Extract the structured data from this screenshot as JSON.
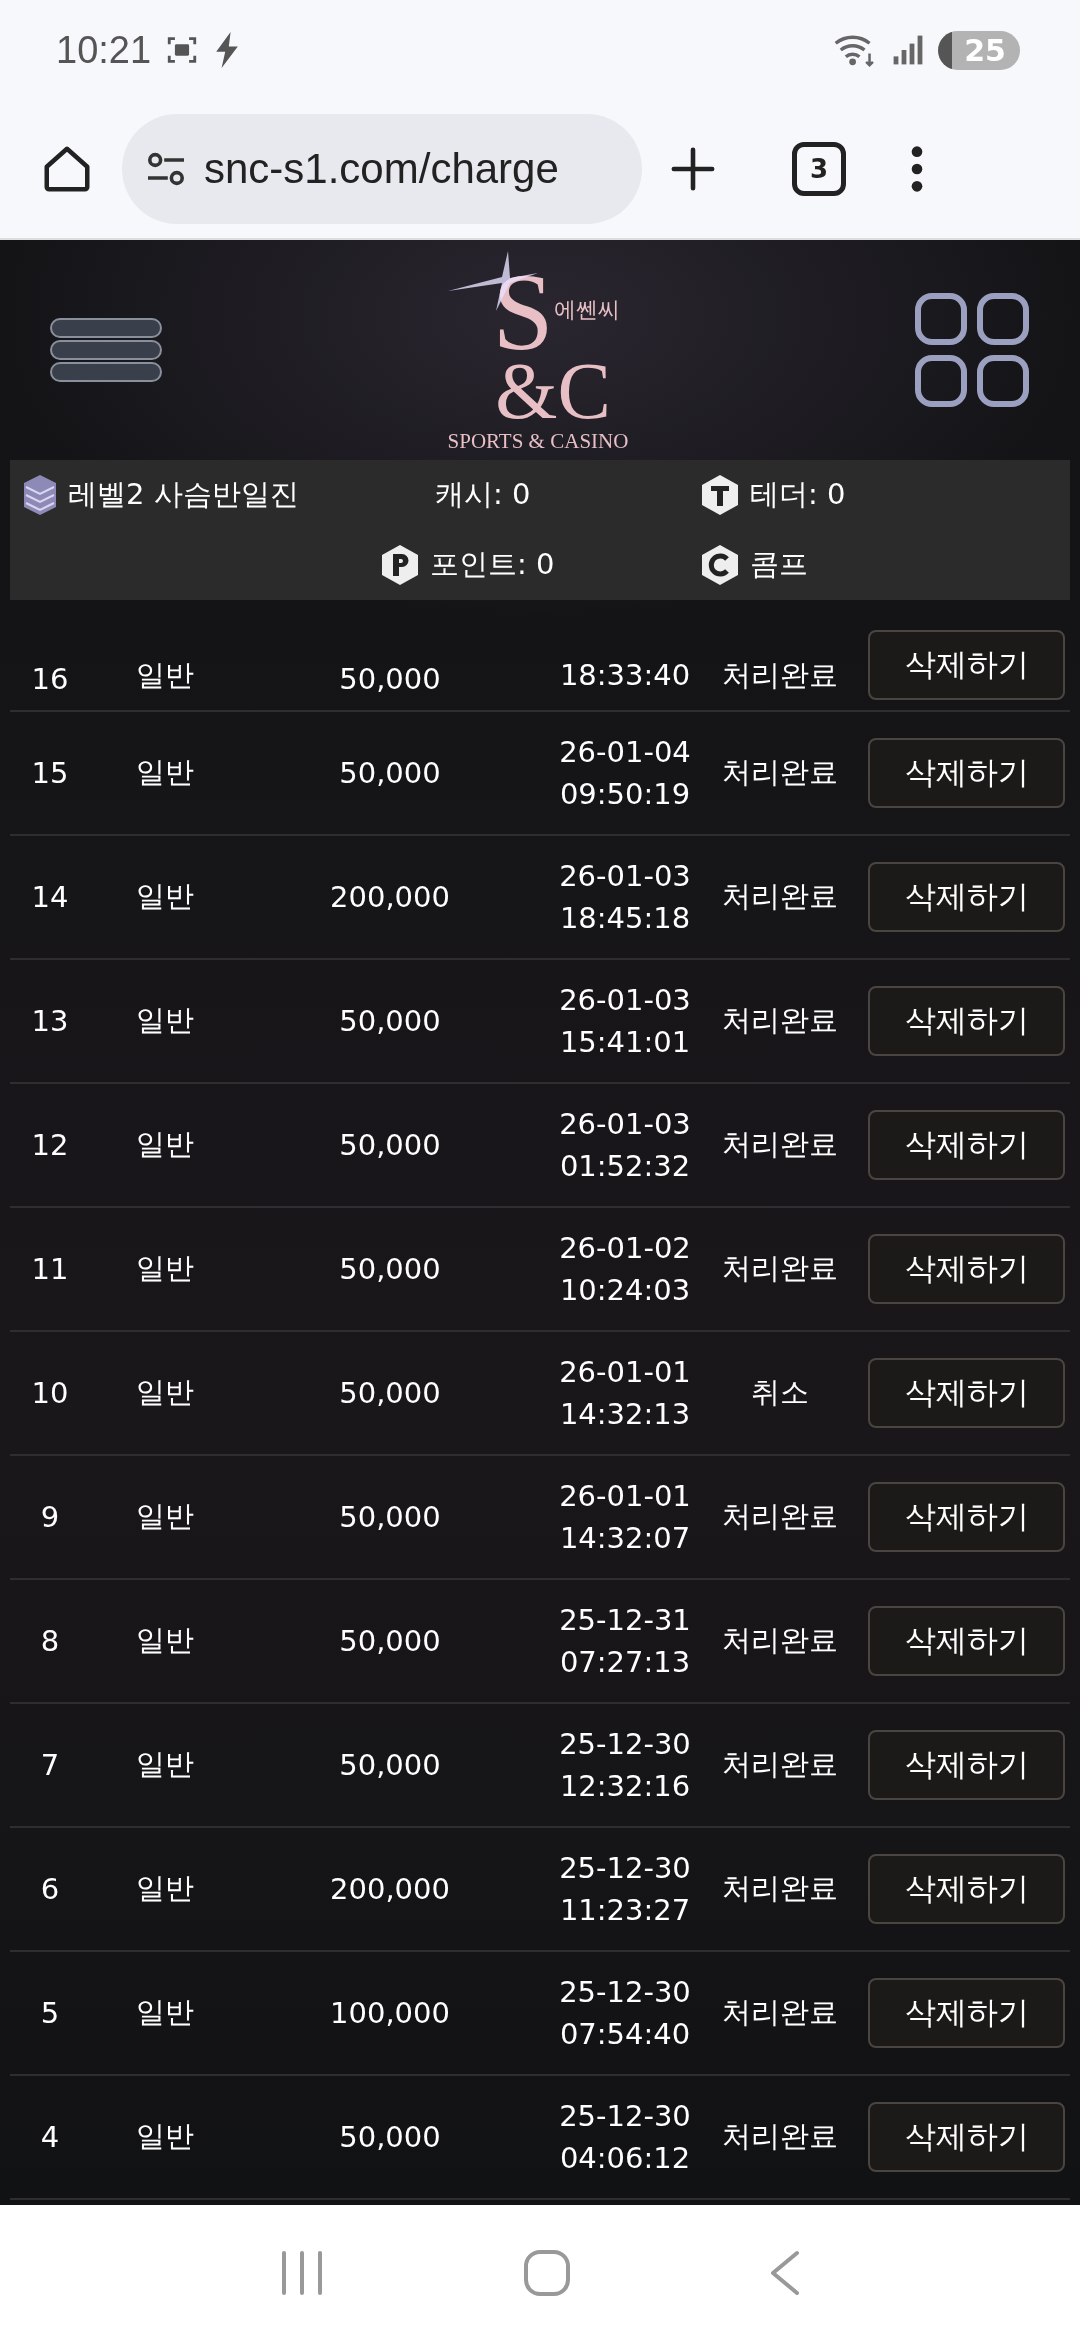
{
  "status_bar": {
    "time": "10:21",
    "battery": "25"
  },
  "browser": {
    "url": "snc-s1.com/charge",
    "tab_count": "3"
  },
  "logo": {
    "mark_top": "S",
    "mark_bottom": "&C",
    "korean": "에쎈씨",
    "tagline": "SPORTS & CASINO"
  },
  "user_panel": {
    "level": "레벨2 사슴반일진",
    "cash": "캐시: 0",
    "tether": "테더: 0",
    "point": "포인트: 0",
    "comp": "콤프"
  },
  "rows": [
    {
      "no": "16",
      "type": "일반",
      "amount": "50,000",
      "time": "18:33:40",
      "status": "처리완료",
      "action": "삭제하기"
    },
    {
      "no": "15",
      "type": "일반",
      "amount": "50,000",
      "date": "26-01-04",
      "time": "09:50:19",
      "status": "처리완료",
      "action": "삭제하기"
    },
    {
      "no": "14",
      "type": "일반",
      "amount": "200,000",
      "date": "26-01-03",
      "time": "18:45:18",
      "status": "처리완료",
      "action": "삭제하기"
    },
    {
      "no": "13",
      "type": "일반",
      "amount": "50,000",
      "date": "26-01-03",
      "time": "15:41:01",
      "status": "처리완료",
      "action": "삭제하기"
    },
    {
      "no": "12",
      "type": "일반",
      "amount": "50,000",
      "date": "26-01-03",
      "time": "01:52:32",
      "status": "처리완료",
      "action": "삭제하기"
    },
    {
      "no": "11",
      "type": "일반",
      "amount": "50,000",
      "date": "26-01-02",
      "time": "10:24:03",
      "status": "처리완료",
      "action": "삭제하기"
    },
    {
      "no": "10",
      "type": "일반",
      "amount": "50,000",
      "date": "26-01-01",
      "time": "14:32:13",
      "status": "취소",
      "action": "삭제하기"
    },
    {
      "no": "9",
      "type": "일반",
      "amount": "50,000",
      "date": "26-01-01",
      "time": "14:32:07",
      "status": "처리완료",
      "action": "삭제하기"
    },
    {
      "no": "8",
      "type": "일반",
      "amount": "50,000",
      "date": "25-12-31",
      "time": "07:27:13",
      "status": "처리완료",
      "action": "삭제하기"
    },
    {
      "no": "7",
      "type": "일반",
      "amount": "50,000",
      "date": "25-12-30",
      "time": "12:32:16",
      "status": "처리완료",
      "action": "삭제하기"
    },
    {
      "no": "6",
      "type": "일반",
      "amount": "200,000",
      "date": "25-12-30",
      "time": "11:23:27",
      "status": "처리완료",
      "action": "삭제하기"
    },
    {
      "no": "5",
      "type": "일반",
      "amount": "100,000",
      "date": "25-12-30",
      "time": "07:54:40",
      "status": "처리완료",
      "action": "삭제하기"
    },
    {
      "no": "4",
      "type": "일반",
      "amount": "50,000",
      "date": "25-12-30",
      "time": "04:06:12",
      "status": "처리완료",
      "action": "삭제하기"
    }
  ]
}
